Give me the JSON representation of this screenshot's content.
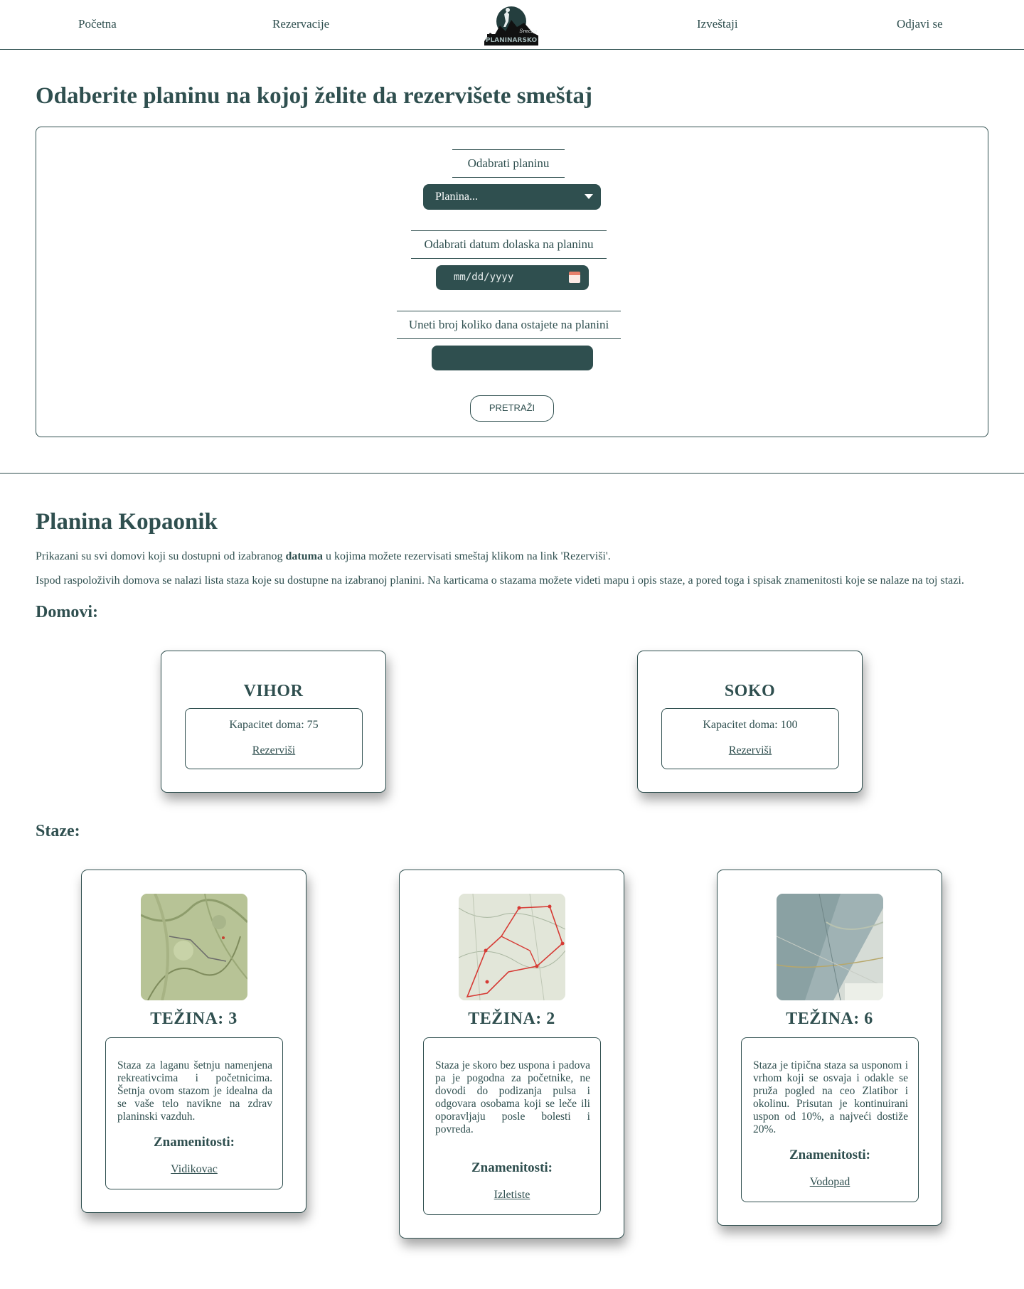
{
  "nav": {
    "items": [
      "Početna",
      "Rezervacije",
      "Izveštaji",
      "Odjavi se"
    ],
    "logo_text": [
      "Srećno",
      "PLANINARSKO"
    ]
  },
  "search": {
    "title": "Odaberite planinu na kojoj želite da rezervišete smeštaj",
    "mountain_label": "Odabrati planinu",
    "mountain_selected": "Planina...",
    "date_label": "Odabrati datum dolaska na planinu",
    "date_placeholder": "mm/dd/yyyy",
    "days_label": "Uneti broj koliko dana ostajete na planini",
    "days_value": "",
    "button": "PRETRAŽI"
  },
  "results": {
    "title": "Planina Kopaonik",
    "intro1_before": "Prikazani su svi domovi koji su dostupni od izabranog ",
    "intro1_bold": "datuma",
    "intro1_after": " u kojima možete rezervisati smeštaj klikom na link 'Rezerviši'.",
    "intro2": "Ispod raspoloživih domova se nalazi lista staza koje su dostupne na izabranoj planini. Na karticama o stazama možete videti mapu i opis staze, a pored toga i spisak znamenitosti koje se nalaze na toj stazi.",
    "homes_heading": "Domovi:",
    "homes": [
      {
        "name": "VIHOR",
        "capacity": "Kapacitet doma: 75",
        "link": "Rezerviši"
      },
      {
        "name": "SOKO",
        "capacity": "Kapacitet doma: 100",
        "link": "Rezerviši"
      }
    ],
    "trails_heading": "Staze:",
    "trails": [
      {
        "difficulty": "TEŽINA: 3",
        "description": "Staza za laganu šetnju namenjena rekreativcima i početnicima. Šetnja ovom stazom je idealna da se vaše telo navikne na zdrav planinski vazduh.",
        "landmarks_title": "Znamenitosti:",
        "landmark": "Vidikovac"
      },
      {
        "difficulty": "TEŽINA: 2",
        "description": "Staza je skoro bez uspona i padova pa je pogodna za početnike, ne dovodi do podizanja pulsa i odgovara osobama koji se leče ili oporavljaju posle bolesti i povreda.",
        "landmarks_title": "Znamenitosti:",
        "landmark": "Izletiste"
      },
      {
        "difficulty": "TEŽINA: 6",
        "description": "Staza je tipična staza sa usponom i vrhom koji se osvaja i odakle se pruža pogled na ceo Zlatibor i okolinu. Prisutan je kontinuirani uspon od 10%, a najveći dostiže 20%.",
        "landmarks_title": "Znamenitosti:",
        "landmark": "Vodopad"
      }
    ]
  },
  "colors": {
    "primary": "#2f4f4f",
    "background": "#ffffff"
  }
}
